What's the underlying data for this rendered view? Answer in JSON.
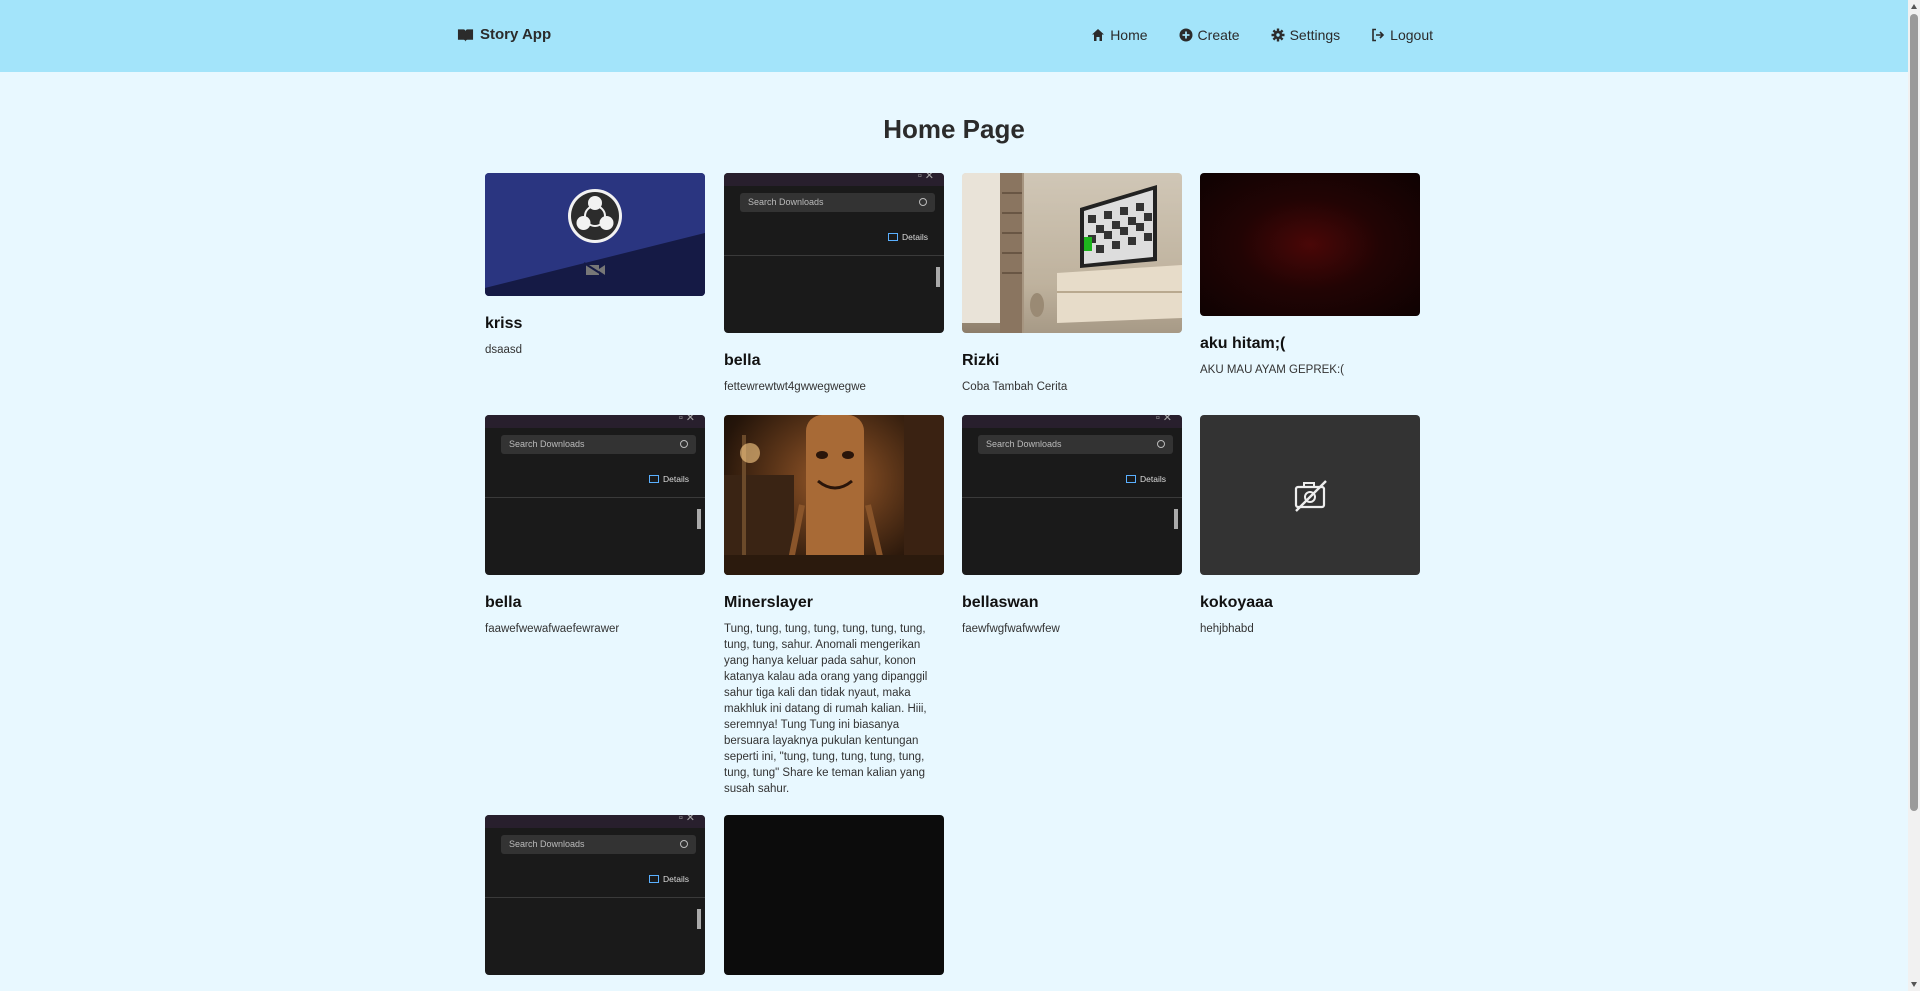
{
  "app": {
    "title": "Story App"
  },
  "nav": {
    "home": "Home",
    "create": "Create",
    "settings": "Settings",
    "logout": "Logout"
  },
  "page": {
    "title": "Home Page"
  },
  "thumb_text": {
    "search": "Search Downloads",
    "details": "Details"
  },
  "stories": [
    {
      "title": "kriss",
      "description": "dsaasd",
      "image": "obs-camera-off"
    },
    {
      "title": "bella",
      "description": "fettewrewtwt4gwwegwegwe",
      "image": "downloads-screenshot"
    },
    {
      "title": "Rizki",
      "description": "Coba Tambah Cerita",
      "image": "room-tv"
    },
    {
      "title": "aku hitam;(",
      "description": "AKU MAU AYAM GEPREK:(",
      "image": "dark-red"
    },
    {
      "title": "bella",
      "description": "faawefwewafwaefewrawer",
      "image": "downloads-screenshot"
    },
    {
      "title": "Minerslayer",
      "description": "Tung, tung, tung, tung, tung, tung, tung, tung, tung, sahur. Anomali mengerikan yang hanya keluar pada sahur, konon katanya kalau ada orang yang dipanggil sahur tiga kali dan tidak nyaut, maka makhluk ini datang di rumah kalian. Hiii, seremnya! Tung Tung ini biasanya bersuara layaknya pukulan kentungan seperti ini, \"tung, tung, tung, tung, tung, tung, tung\" Share ke teman kalian yang susah sahur.",
      "image": "wooden-figure"
    },
    {
      "title": "bellaswan",
      "description": "faewfwgfwafwwfew",
      "image": "downloads-screenshot"
    },
    {
      "title": "kokoyaaa",
      "description": "hehjbhabd",
      "image": "no-image"
    },
    {
      "title": "",
      "description": "",
      "image": "downloads-screenshot"
    },
    {
      "title": "",
      "description": "",
      "image": "dark"
    }
  ]
}
